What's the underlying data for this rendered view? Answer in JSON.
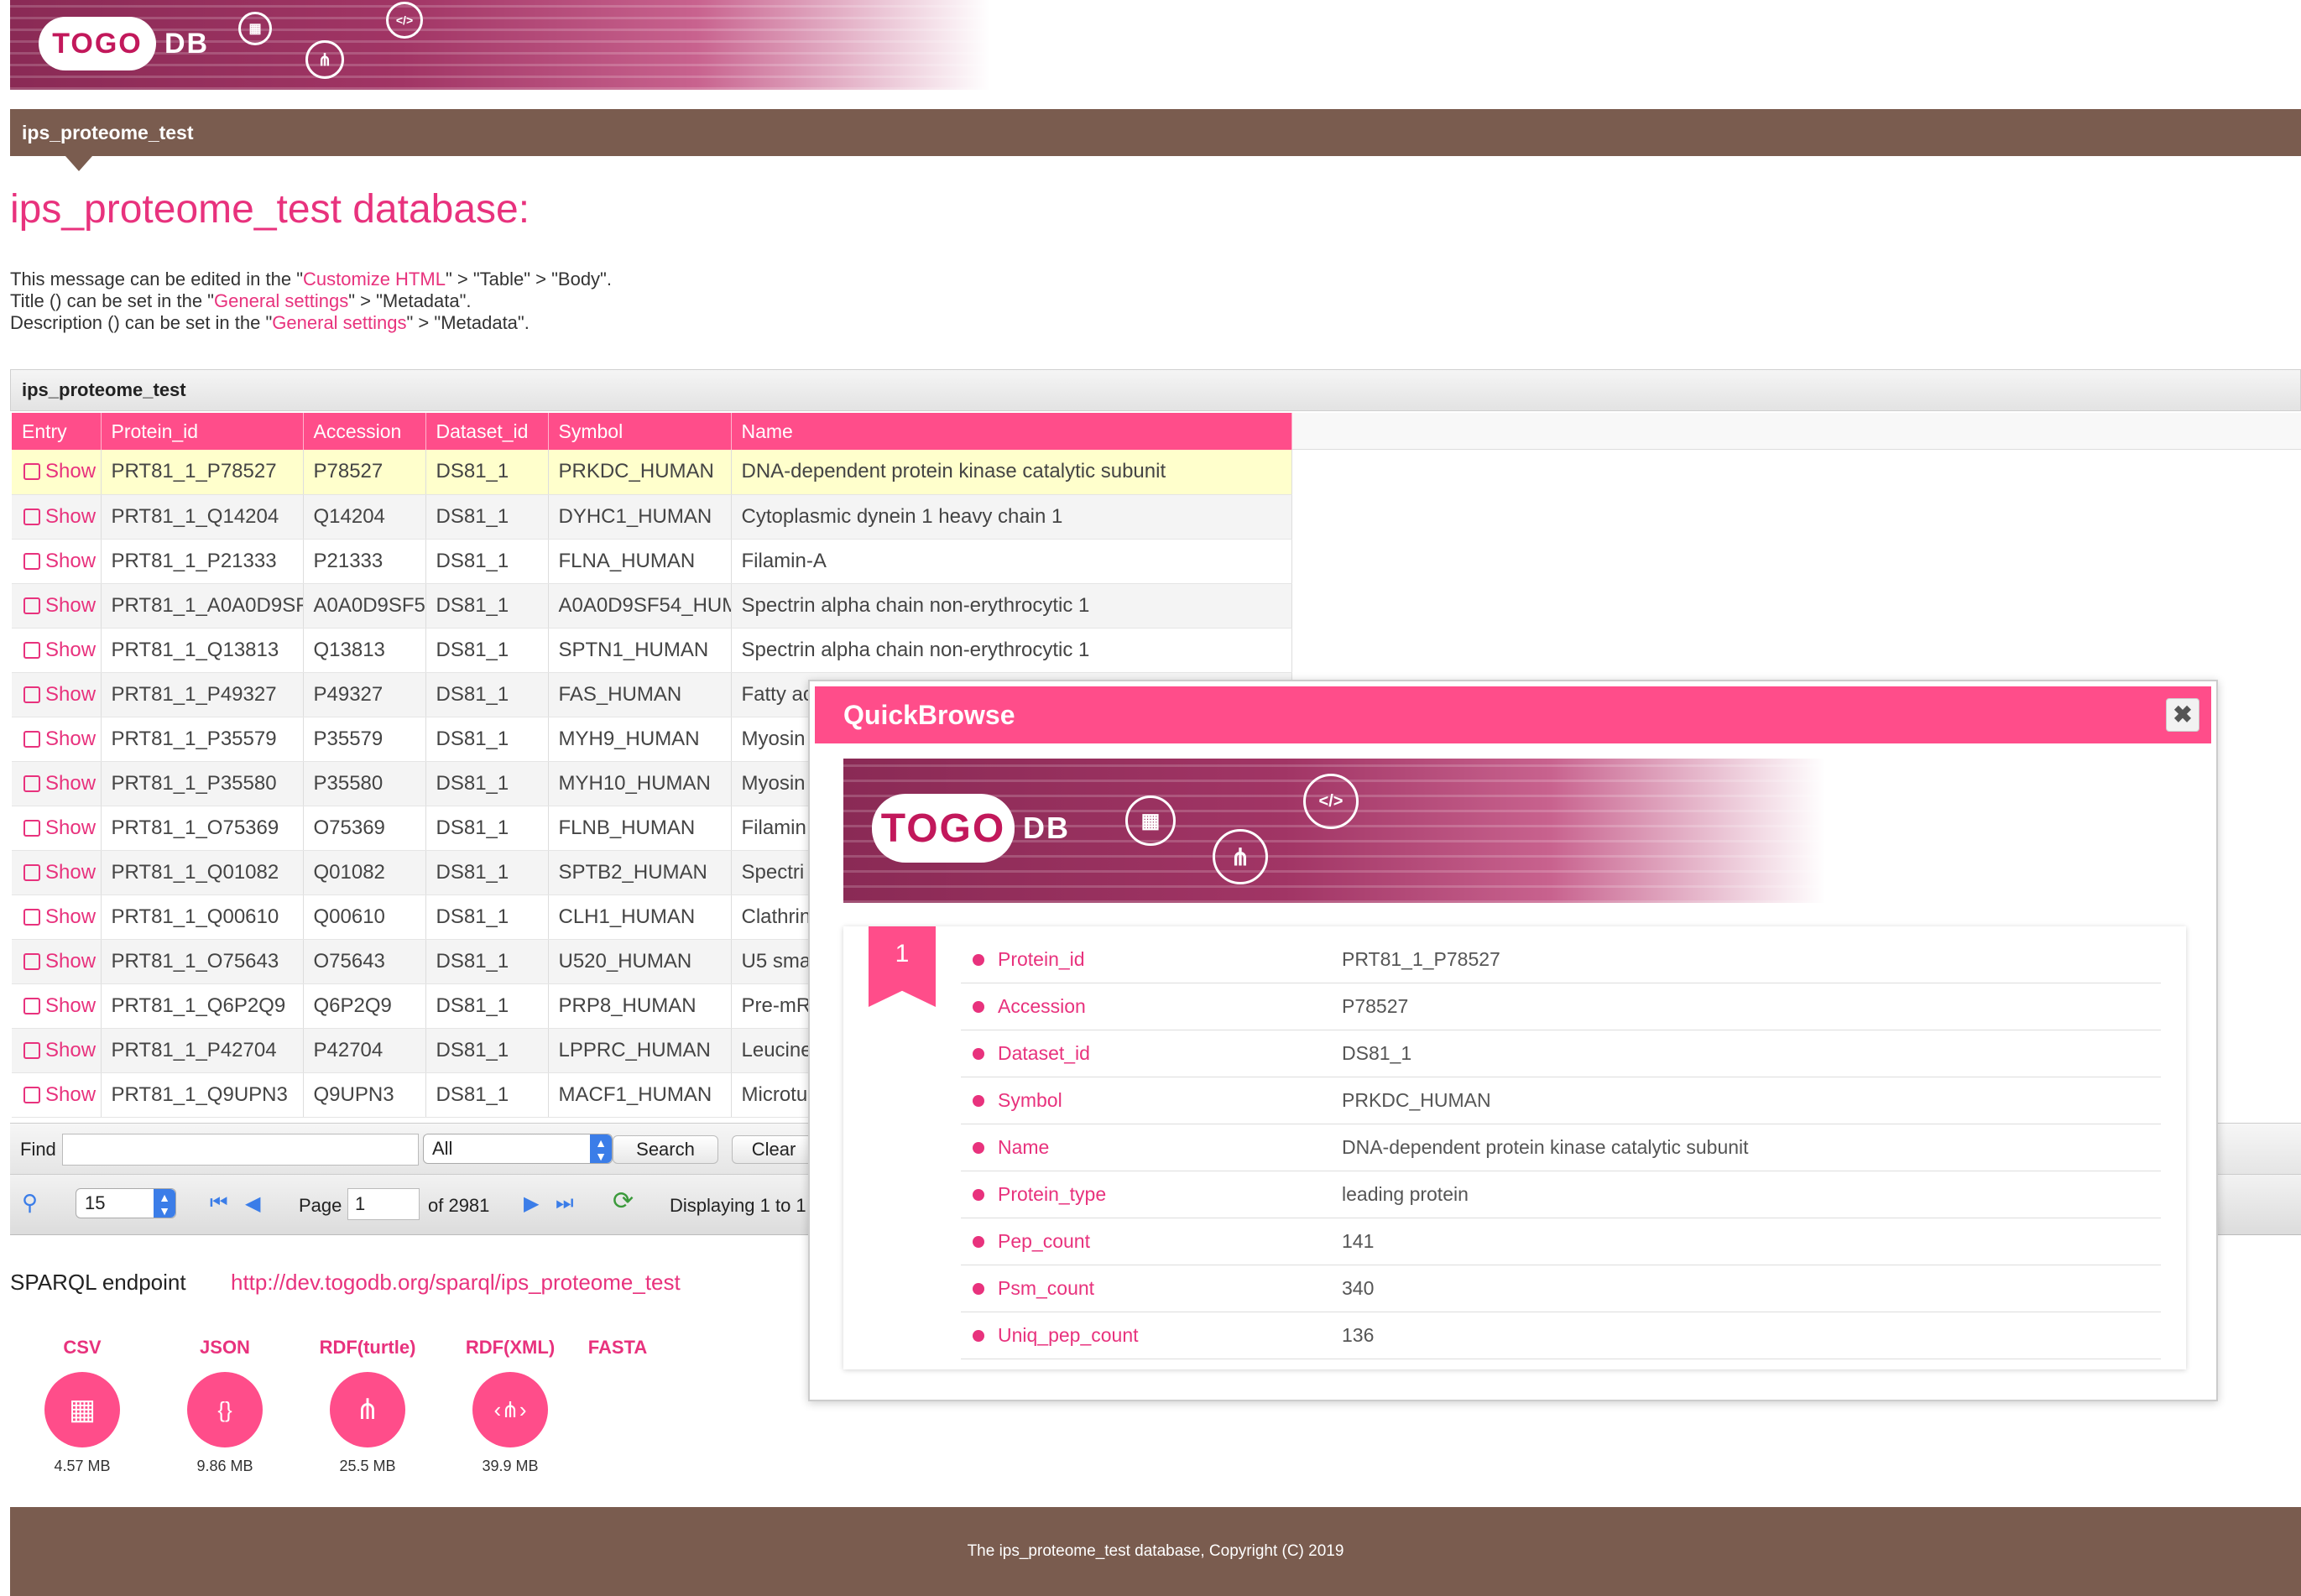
{
  "brand": {
    "logo_text": "TOGO",
    "logo_db": "DB"
  },
  "colors": {
    "accent": "#ff4d8a",
    "link": "#e8327d",
    "nav_bg": "#7a5c4f"
  },
  "nav": {
    "tab_label": "ips_proteome_test"
  },
  "page": {
    "title": "ips_proteome_test database:",
    "desc1": {
      "pre": "This message can be edited in the \"",
      "link": "Customize HTML",
      "post": "\" > \"Table\" > \"Body\"."
    },
    "desc2": {
      "pre": "Title () can be set in the \"",
      "link": "General settings",
      "post": "\" > \"Metadata\"."
    },
    "desc3": {
      "pre": "Description () can be set in the \"",
      "link": "General settings",
      "post": "\" > \"Metadata\"."
    }
  },
  "grid": {
    "title": "ips_proteome_test",
    "columns": [
      "Entry",
      "Protein_id",
      "Accession",
      "Dataset_id",
      "Symbol",
      "Name"
    ],
    "show_label": "Show",
    "rows": [
      [
        "PRT81_1_P78527",
        "P78527",
        "DS81_1",
        "PRKDC_HUMAN",
        "DNA-dependent protein kinase catalytic subunit"
      ],
      [
        "PRT81_1_Q14204",
        "Q14204",
        "DS81_1",
        "DYHC1_HUMAN",
        "Cytoplasmic dynein 1 heavy chain 1"
      ],
      [
        "PRT81_1_P21333",
        "P21333",
        "DS81_1",
        "FLNA_HUMAN",
        "Filamin-A"
      ],
      [
        "PRT81_1_A0A0D9SF",
        "A0A0D9SF5",
        "DS81_1",
        "A0A0D9SF54_HUM",
        "Spectrin alpha chain non-erythrocytic 1"
      ],
      [
        "PRT81_1_Q13813",
        "Q13813",
        "DS81_1",
        "SPTN1_HUMAN",
        "Spectrin alpha chain non-erythrocytic 1"
      ],
      [
        "PRT81_1_P49327",
        "P49327",
        "DS81_1",
        "FAS_HUMAN",
        "Fatty ac"
      ],
      [
        "PRT81_1_P35579",
        "P35579",
        "DS81_1",
        "MYH9_HUMAN",
        "Myosin"
      ],
      [
        "PRT81_1_P35580",
        "P35580",
        "DS81_1",
        "MYH10_HUMAN",
        "Myosin"
      ],
      [
        "PRT81_1_O75369",
        "O75369",
        "DS81_1",
        "FLNB_HUMAN",
        "Filamin"
      ],
      [
        "PRT81_1_Q01082",
        "Q01082",
        "DS81_1",
        "SPTB2_HUMAN",
        "Spectri"
      ],
      [
        "PRT81_1_Q00610",
        "Q00610",
        "DS81_1",
        "CLH1_HUMAN",
        "Clathrin"
      ],
      [
        "PRT81_1_O75643",
        "O75643",
        "DS81_1",
        "U520_HUMAN",
        "U5 sma"
      ],
      [
        "PRT81_1_Q6P2Q9",
        "Q6P2Q9",
        "DS81_1",
        "PRP8_HUMAN",
        "Pre-mR"
      ],
      [
        "PRT81_1_P42704",
        "P42704",
        "DS81_1",
        "LPPRC_HUMAN",
        "Leucine"
      ],
      [
        "PRT81_1_Q9UPN3",
        "Q9UPN3",
        "DS81_1",
        "MACF1_HUMAN",
        "Microtu"
      ]
    ]
  },
  "find": {
    "label": "Find",
    "value": "",
    "scope": "All",
    "search_label": "Search",
    "clear_label": "Clear"
  },
  "pager": {
    "per_page": "15",
    "page_label": "Page",
    "page_value": "1",
    "of_label": "of 2981",
    "display_text": "Displaying 1 to 1"
  },
  "sparql": {
    "label": "SPARQL endpoint",
    "url": "http://dev.togodb.org/sparql/ips_proteome_test"
  },
  "downloads": [
    {
      "name": "CSV",
      "size": "4.57 MB",
      "icon": "table-icon"
    },
    {
      "name": "JSON",
      "size": "9.86 MB",
      "icon": "json-icon"
    },
    {
      "name": "RDF(turtle)",
      "size": "25.5 MB",
      "icon": "share-icon"
    },
    {
      "name": "RDF(XML)",
      "size": "39.9 MB",
      "icon": "share-xml-icon"
    },
    {
      "name": "FASTA",
      "size": "",
      "icon": ""
    }
  ],
  "footer": {
    "text": "The ips_proteome_test database, Copyright (C) 2019"
  },
  "quickbrowse": {
    "title": "QuickBrowse",
    "close_glyph": "✖",
    "record_number": "1",
    "fields": [
      {
        "key": "Protein_id",
        "value": "PRT81_1_P78527"
      },
      {
        "key": "Accession",
        "value": "P78527"
      },
      {
        "key": "Dataset_id",
        "value": "DS81_1"
      },
      {
        "key": "Symbol",
        "value": "PRKDC_HUMAN"
      },
      {
        "key": "Name",
        "value": "DNA-dependent protein kinase catalytic subunit"
      },
      {
        "key": "Protein_type",
        "value": "leading protein"
      },
      {
        "key": "Pep_count",
        "value": "141"
      },
      {
        "key": "Psm_count",
        "value": "340"
      },
      {
        "key": "Uniq_pep_count",
        "value": "136"
      }
    ]
  }
}
